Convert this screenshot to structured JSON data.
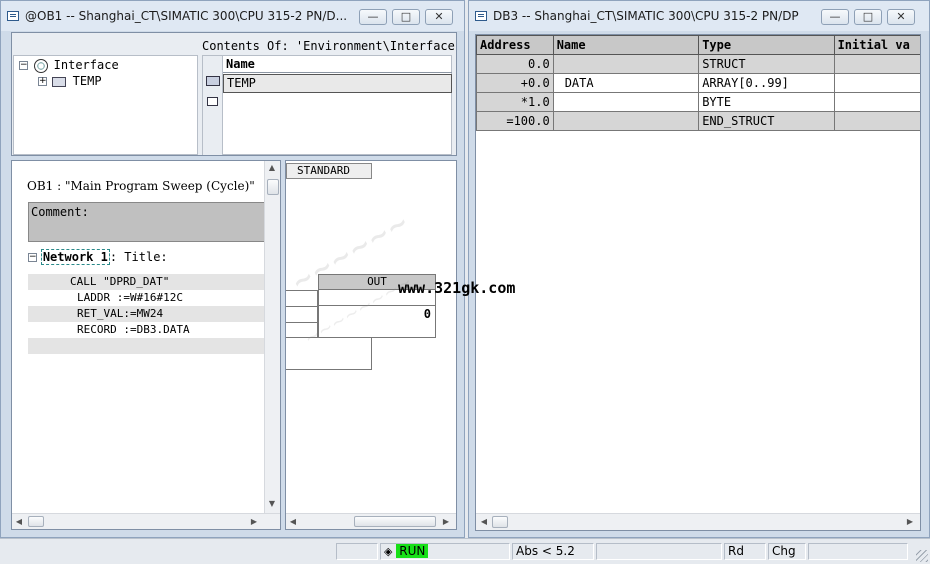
{
  "left_window": {
    "title": "@OB1 -- Shanghai_CT\\SIMATIC 300\\CPU 315-2 PN/D...",
    "minimize": "—",
    "maximize": "□",
    "close": "✕",
    "tree": {
      "root_label": "Interface",
      "child_label": "TEMP"
    },
    "contents": {
      "header": "Contents Of: 'Environment\\Interface'",
      "column_name": "Name",
      "row_label": "TEMP"
    },
    "code": {
      "ob_line": "OB1 :  \"Main Program Sweep (Cycle)\"",
      "comment_label": "Comment:",
      "network_label": "Network 1",
      "network_title": ": Title:",
      "stl_lines": [
        "CALL  \"DPRD_DAT\"",
        "LADDR  :=W#16#12C",
        "RET_VAL:=MW24",
        "RECORD :=DB3.DATA"
      ]
    },
    "catalog": {
      "tab": "STANDARD",
      "out_header": "OUT",
      "out_value": "0",
      "watermark_text": "www.321gk.com"
    }
  },
  "right_window": {
    "title": "DB3 -- Shanghai_CT\\SIMATIC 300\\CPU 315-2 PN/DP",
    "minimize": "—",
    "maximize": "□",
    "close": "✕",
    "table": {
      "columns": [
        "Address",
        "Name",
        "Type",
        "Initial va"
      ],
      "rows": [
        {
          "address": "0.0",
          "name": "",
          "type": "STRUCT",
          "initial": ""
        },
        {
          "address": "+0.0",
          "name": "DATA",
          "type": "ARRAY[0..99]",
          "initial": ""
        },
        {
          "address": "*1.0",
          "name": "",
          "type": "BYTE",
          "initial": ""
        },
        {
          "address": "=100.0",
          "name": "",
          "type": "END_STRUCT",
          "initial": ""
        }
      ]
    }
  },
  "statusbar": {
    "run_icon": "◈",
    "run_label": "RUN",
    "abs_label": "Abs < 5.2",
    "rd_label": "Rd",
    "chg_label": "Chg"
  },
  "colors": {
    "run_green": "#17e017",
    "header_gray": "#c8c8c8",
    "comment_gray": "#c0c0c0"
  }
}
